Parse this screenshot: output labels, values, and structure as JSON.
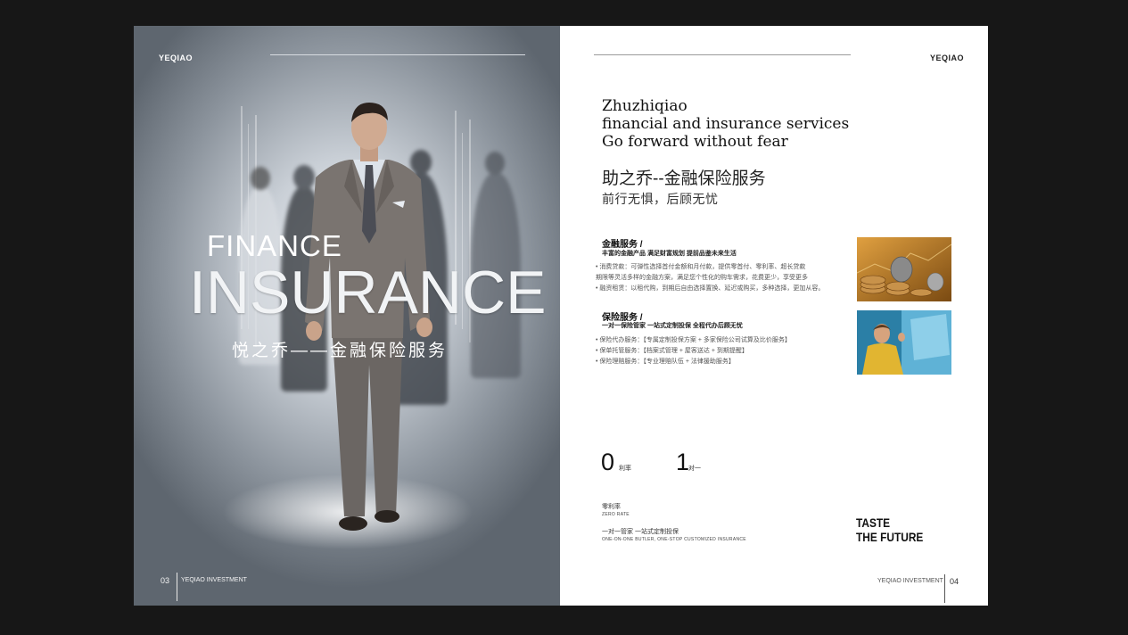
{
  "left_page": {
    "brand": "YEQIAO",
    "title_top": "FINANCE",
    "title_main": "INSURANCE",
    "subtitle_cn": "悦之乔——金融保险服务",
    "page_number": "03",
    "footer_label": "YEQIAO INVESTMENT"
  },
  "right_page": {
    "brand": "YEQIAO",
    "headline": [
      "Zhuzhiqiao",
      "financial and insurance services",
      "Go forward without fear"
    ],
    "title_cn": "助之乔--金融保险服务",
    "subtitle_cn": "前行无惧，后顾无忧",
    "section1": {
      "title": "金融服务 /",
      "subtitle": "丰富的金融产品 满足财富规划 提前品鉴未来生活",
      "bullets": [
        "• 消费贷款：可弹性选择首付金额和月付款，提供零首付、零利率、超长贷款",
        "  期限等灵活多样的金融方案，满足您个性化的购车需求，花费更少，享受更多",
        "• 融资租赁：以租代购，到期后自由选择置换、延迟或购买，多种选择，更加从容。"
      ]
    },
    "section2": {
      "title": "保险服务 /",
      "subtitle": "一对一保险管家 一站式定制投保 全程代办后顾无忧",
      "bullets": [
        "• 保险代办服务：【专属定制投保方案 + 多家保险公司试算及比价服务】",
        "• 保单托管服务：【档案式管理 + 屋客送达 + 到期提醒】",
        "• 保险理赔服务：【专业理赔队伍 + 法律援助服务】"
      ]
    },
    "stats": [
      {
        "number": "0",
        "label": "利率"
      },
      {
        "number": "1",
        "label": "对一"
      }
    ],
    "zero_rate_cn": "零利率",
    "zero_rate_en": "ZERO RATE",
    "butler_cn": "一对一管家 一站式定制投保",
    "butler_en": "ONE-ON-ONE BUTLER, ONE-STOP CUSTOMIZED INSURANCE",
    "taste": [
      "TASTE",
      "THE FUTURE"
    ],
    "footer_label": "YEQIAO INVESTMENT",
    "page_number": "04"
  }
}
